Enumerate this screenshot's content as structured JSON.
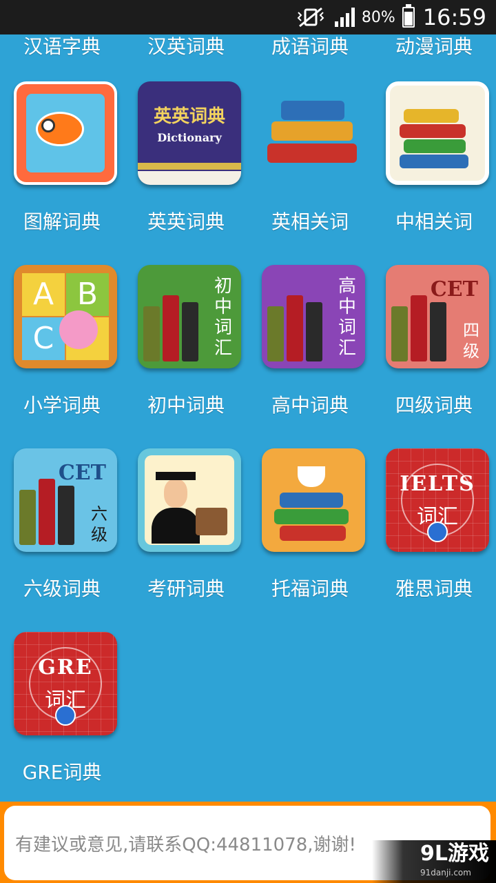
{
  "status_bar": {
    "battery_percent": "80%",
    "time": "16:59",
    "icons": [
      "mute-vibrate-icon",
      "signal-icon",
      "battery-charging-icon"
    ]
  },
  "top_row_labels": [
    "汉语字典",
    "汉英词典",
    "成语词典",
    "动漫词典"
  ],
  "apps": [
    {
      "label": "图解词典",
      "icon": "clownfish-icon"
    },
    {
      "label": "英英词典",
      "icon": "dictionary-book-icon",
      "icon_text": "英英词典",
      "icon_subtext": "Dictionary"
    },
    {
      "label": "英相关词",
      "icon": "book-stack-icon"
    },
    {
      "label": "中相关词",
      "icon": "books-glasses-icon"
    },
    {
      "label": "小学词典",
      "icon": "abc-star-icon",
      "letters": [
        "A",
        "B",
        "C"
      ]
    },
    {
      "label": "初中词典",
      "icon": "junior-vocab-icon",
      "icon_text": "初中词汇"
    },
    {
      "label": "高中词典",
      "icon": "senior-vocab-icon",
      "icon_text": "高中词汇"
    },
    {
      "label": "四级词典",
      "icon": "cet4-icon",
      "icon_text": "CET",
      "icon_subtext": "四级"
    },
    {
      "label": "六级词典",
      "icon": "cet6-icon",
      "icon_text": "CET",
      "icon_subtext": "六级"
    },
    {
      "label": "考研词典",
      "icon": "graduate-icon"
    },
    {
      "label": "托福词典",
      "icon": "teacup-books-icon"
    },
    {
      "label": "雅思词典",
      "icon": "ielts-icon",
      "icon_text": "IELTS",
      "icon_subtext": "词汇"
    },
    {
      "label": "GRE词典",
      "icon": "gre-icon",
      "icon_text": "GRE",
      "icon_subtext": "词汇"
    }
  ],
  "footer": {
    "message": "有建议或意见,请联系QQ:44811078,谢谢!"
  },
  "watermark": {
    "logo": "9L游戏",
    "site": "91danji.com"
  },
  "colors": {
    "background": "#2ea3d6",
    "footer_border": "#ff8a00",
    "status_bar": "#1c1c1c"
  }
}
